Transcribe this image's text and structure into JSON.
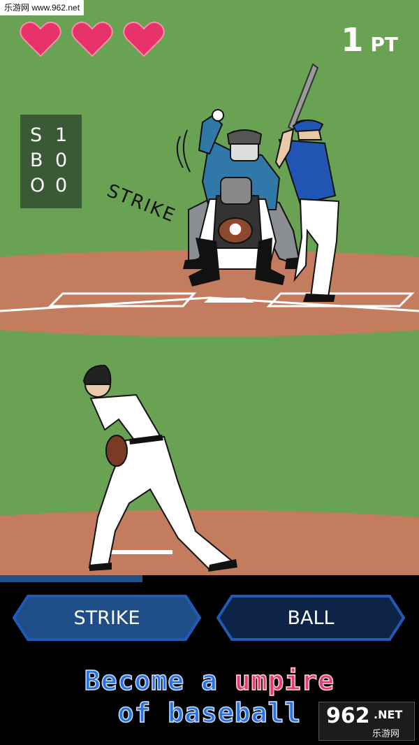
{
  "watermark": {
    "top_left": "乐游网 www.962.net",
    "bottom_right_logo": "962",
    "bottom_right_suffix": ".NET",
    "bottom_right_cn": "乐游网"
  },
  "hud": {
    "lives_remaining": 3,
    "score_value": "1",
    "score_unit": "PT"
  },
  "sbo": [
    {
      "key": "S",
      "value": "1"
    },
    {
      "key": "B",
      "value": "0"
    },
    {
      "key": "O",
      "value": "0"
    }
  ],
  "call_text": "STRIKE",
  "pitch_timer_progress": 0.34,
  "buttons": {
    "strike": "STRIKE",
    "ball": "BALL"
  },
  "promo": {
    "line1_a": "Become a ",
    "line1_b": "umpire",
    "line2": "of baseball"
  },
  "colors": {
    "grass": "#6aa253",
    "dirt": "#c47c5e",
    "heart": "#e8336a",
    "sbo_board": "#3a5a36",
    "button_fill": "#1e4d87",
    "button_fill_dark": "#0d2448",
    "button_border": "#1f5bb5",
    "progress": "#1e5287",
    "promo_blue": "#2a72e0",
    "promo_pink": "#ea3c6b"
  }
}
